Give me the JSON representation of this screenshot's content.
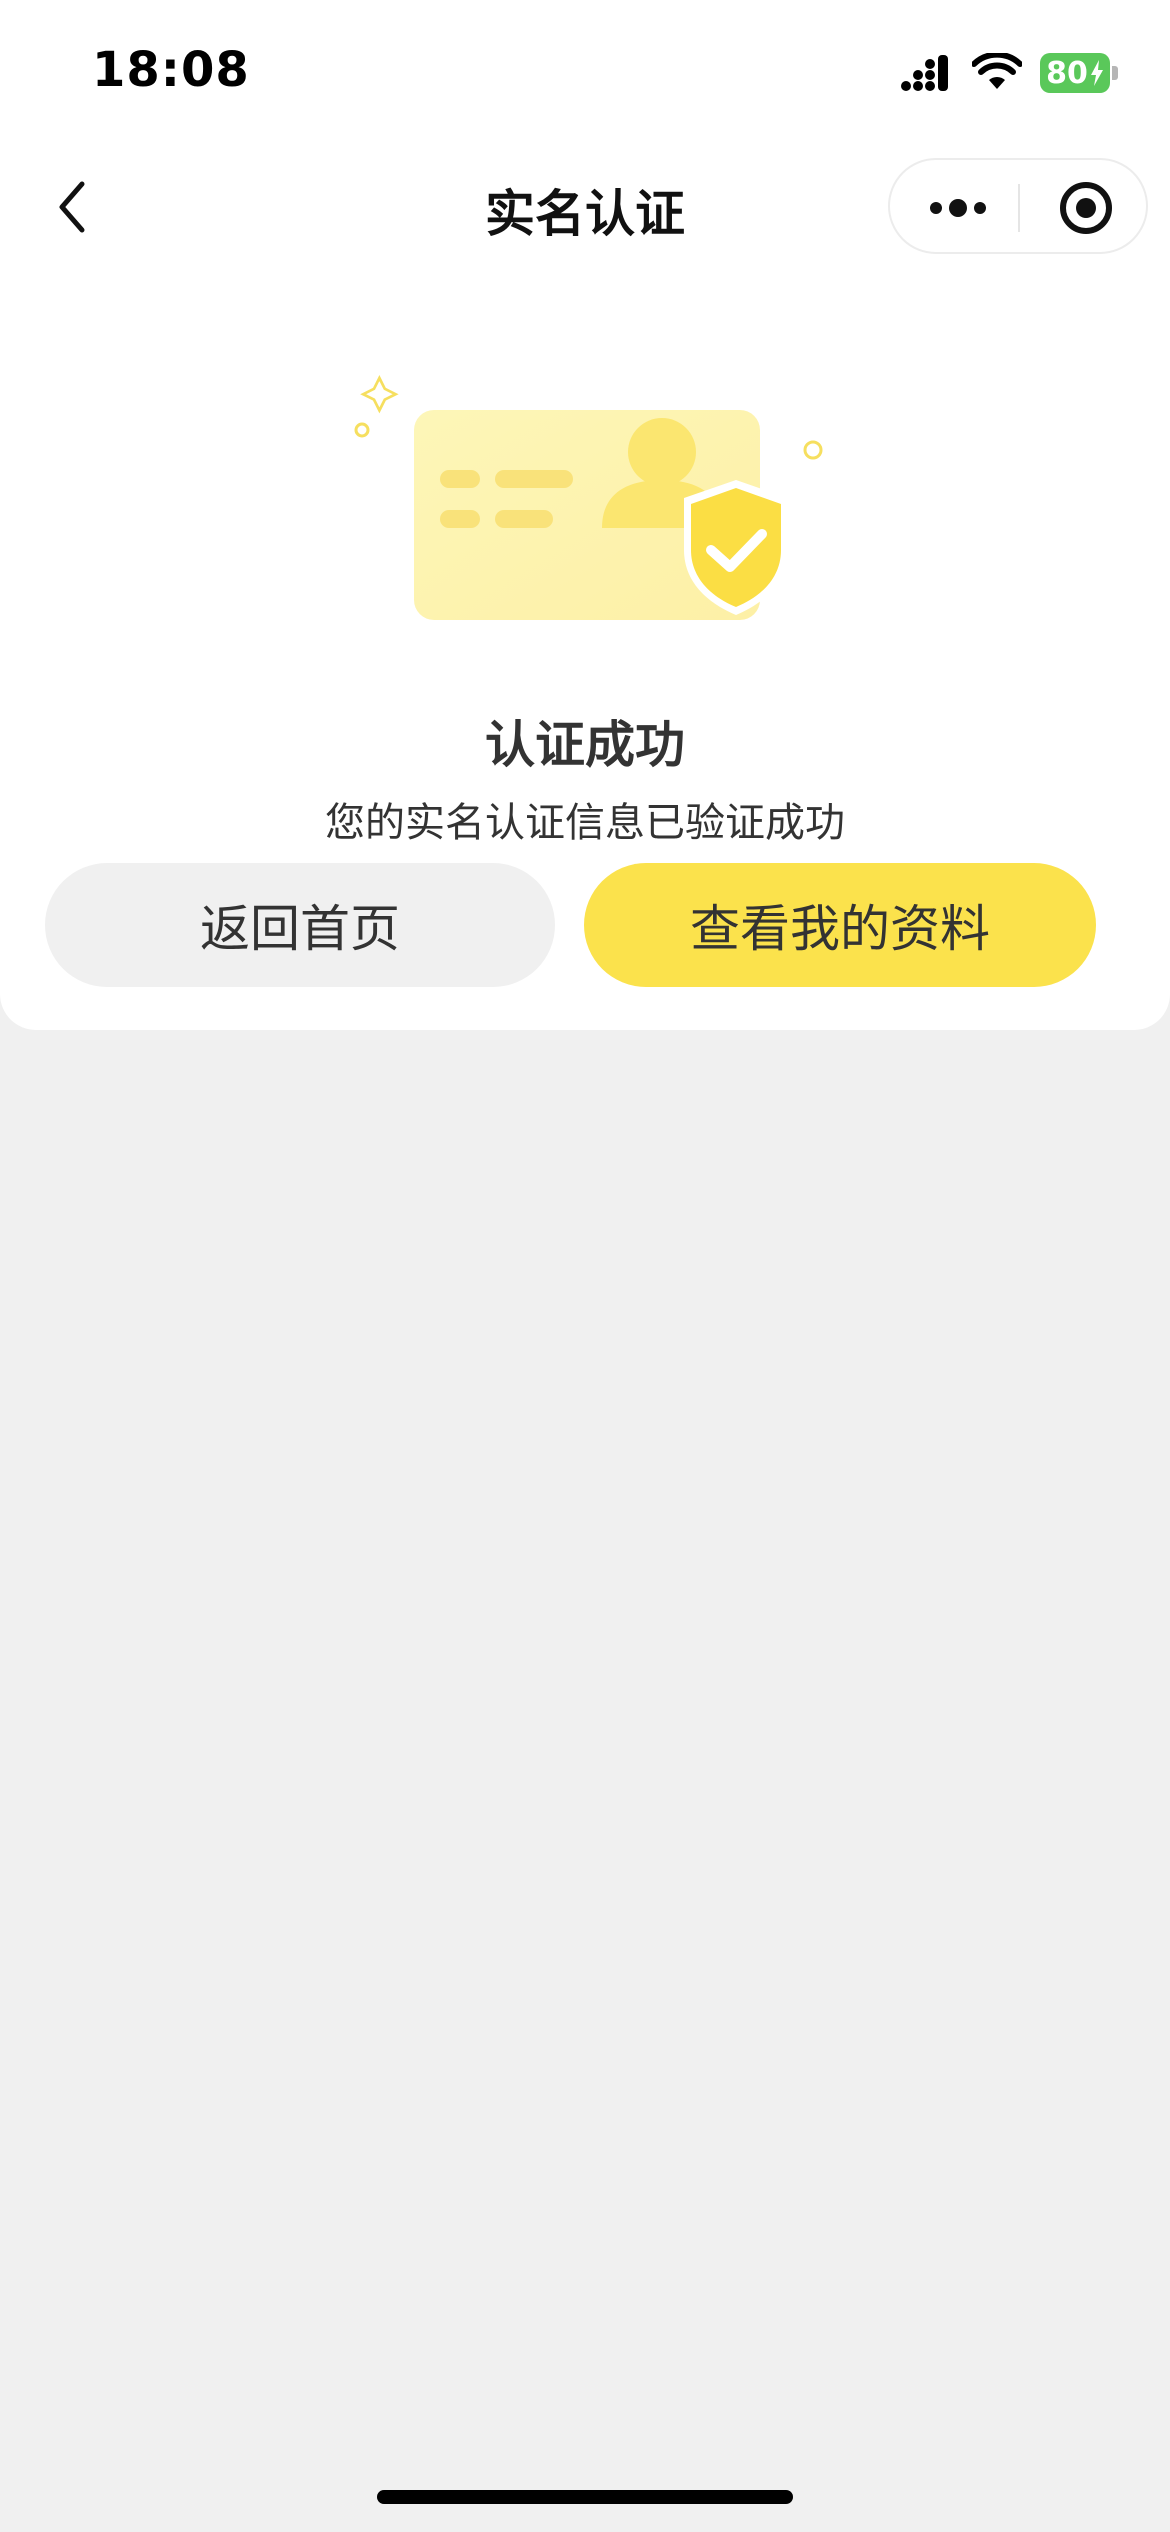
{
  "status_bar": {
    "time": "18:08",
    "battery": "80",
    "icons": [
      "signal-icon",
      "wifi-icon",
      "battery-icon"
    ]
  },
  "navbar": {
    "title": "实名认证",
    "icons": [
      "back-icon",
      "more-icon",
      "close-mini-program-icon"
    ]
  },
  "result": {
    "title": "认证成功",
    "subtitle": "您的实名认证信息已验证成功"
  },
  "actions": {
    "home_label": "返回首页",
    "profile_label": "查看我的资料"
  },
  "colors": {
    "accent": "#fbe24c",
    "secondary_button": "#f0f0f0",
    "background": "#f0f0f0",
    "card": "#ffffff"
  }
}
